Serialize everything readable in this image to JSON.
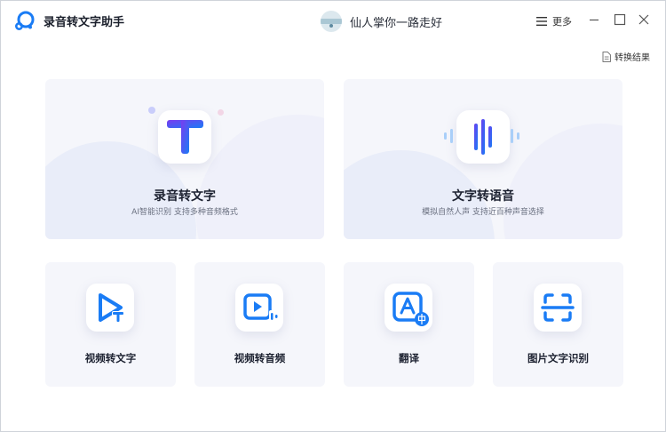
{
  "app": {
    "title": "录音转文字助手"
  },
  "header": {
    "user_name": "仙人掌你一路走好",
    "more_label": "更多"
  },
  "toolbar": {
    "result_label": "转换结果"
  },
  "features": {
    "main": [
      {
        "title": "录音转文字",
        "subtitle": "AI智能识别 支持多种音频格式",
        "icon": "text-t-icon"
      },
      {
        "title": "文字转语音",
        "subtitle": "模拟自然人声 支持近百种声音选择",
        "icon": "sound-wave-icon"
      }
    ],
    "secondary": [
      {
        "title": "视频转文字",
        "icon": "video-text-icon"
      },
      {
        "title": "视频转音频",
        "icon": "video-audio-icon"
      },
      {
        "title": "翻译",
        "icon": "translate-icon"
      },
      {
        "title": "图片文字识别",
        "icon": "image-ocr-icon"
      }
    ]
  },
  "colors": {
    "accent": "#1a7cf5",
    "accent_purple": "#5b43e8",
    "card_bg": "#f5f6fb",
    "border": "#cfd3da"
  }
}
